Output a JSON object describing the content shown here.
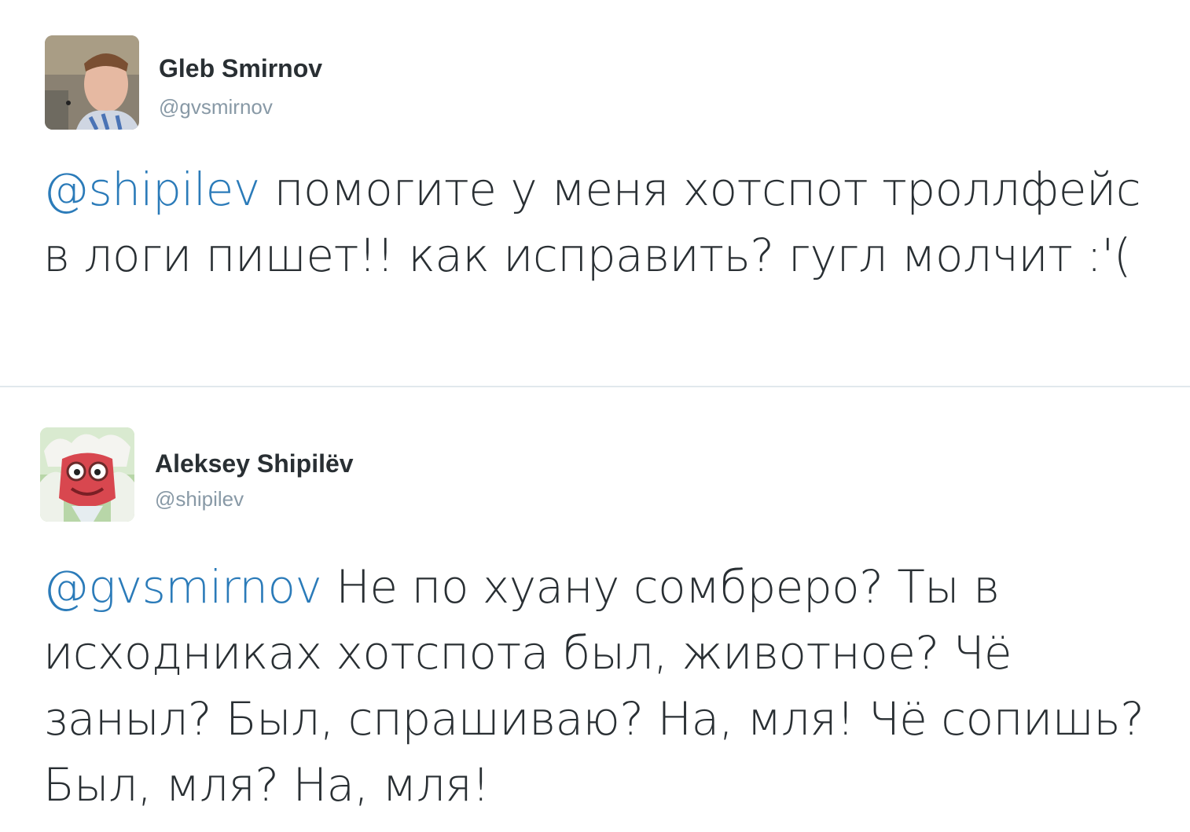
{
  "tweets": [
    {
      "author": {
        "name": "Gleb Smirnov",
        "handle": "@gvsmirnov",
        "avatar_icon": "avatar-photo-icon"
      },
      "mention": "@shipilev",
      "text": " помогите у меня хотспот троллфейс в логи пишет!! как исправить? гугл молчит :'("
    },
    {
      "author": {
        "name": "Aleksey Shipilёv",
        "handle": "@shipilev",
        "avatar_icon": "avatar-cartoon-icon"
      },
      "mention": "@gvsmirnov",
      "text": " Не по хуану сомбреро? Ты в исходниках хотспота был, животное? Чё заныл? Был, спрашиваю? На, мля! Чё сопишь? Был, мля? На, мля!"
    }
  ],
  "colors": {
    "text": "#292f33",
    "mention": "#2b7bb9",
    "handle": "#8899a6",
    "divider": "#e1e8ed"
  }
}
